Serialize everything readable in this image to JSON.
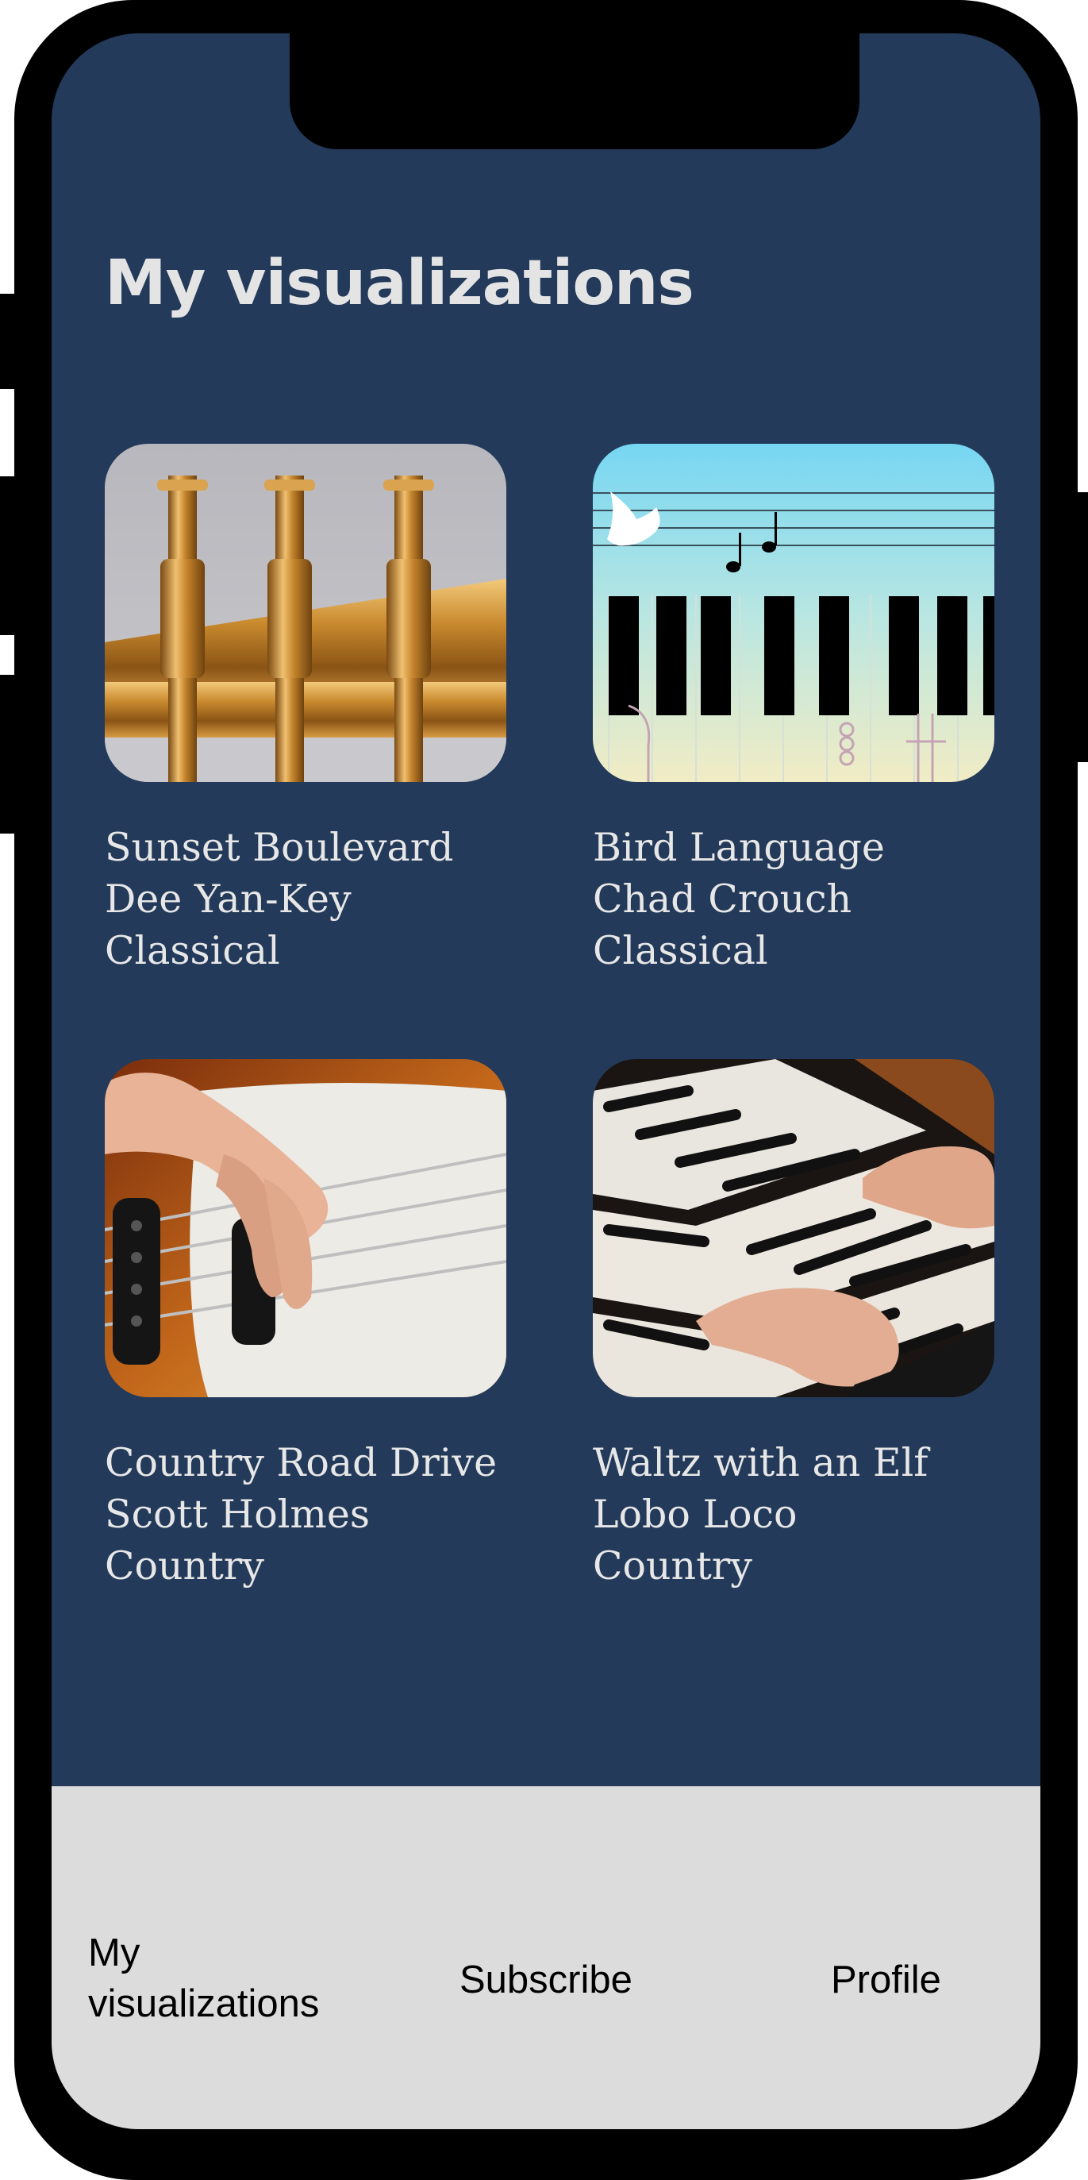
{
  "page": {
    "title": "My visualizations"
  },
  "visualizations": [
    {
      "title": "Sunset Boulevard",
      "artist": "Dee Yan-Key",
      "genre": "Classical",
      "image": "trumpet-valves"
    },
    {
      "title": "Bird Language",
      "artist": "Chad Crouch",
      "genre": "Classical",
      "image": "bird-piano"
    },
    {
      "title": "Country Road Drive",
      "artist": "Scott Holmes",
      "genre": "Country",
      "image": "bass-guitar"
    },
    {
      "title": "Waltz with an Elf",
      "artist": "Lobo Loco",
      "genre": "Country",
      "image": "organ-keys"
    }
  ],
  "tabbar": {
    "tab1_line1": "My",
    "tab1_line2": "visualizations",
    "tab2": "Subscribe",
    "tab3": "Profile"
  },
  "colors": {
    "screen_bg": "#233a5a",
    "tabbar_bg": "#dcdcdc",
    "text": "#e7e7e7"
  }
}
